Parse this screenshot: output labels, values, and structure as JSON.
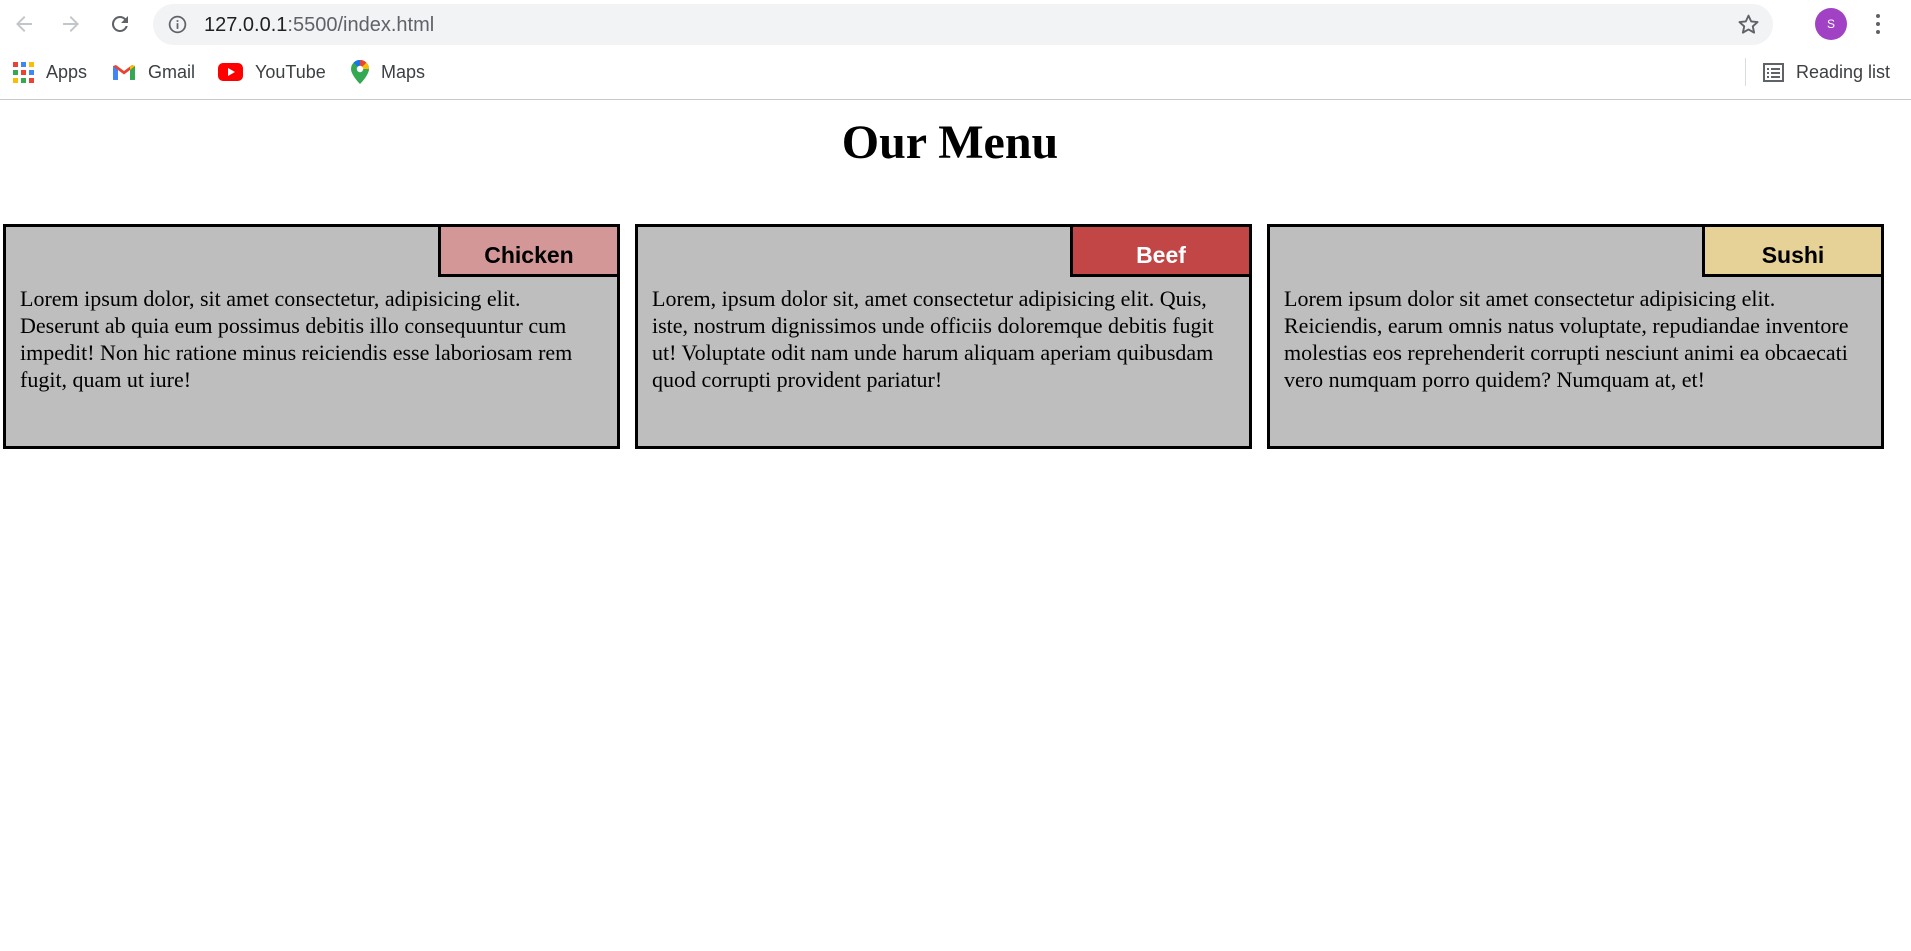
{
  "browser": {
    "url_host": "127.0.0.1",
    "url_path": ":5500/index.html",
    "avatar_letter": "S",
    "bookmarks": [
      {
        "label": "Apps",
        "icon": "apps-grid-icon"
      },
      {
        "label": "Gmail",
        "icon": "gmail-icon"
      },
      {
        "label": "YouTube",
        "icon": "youtube-icon"
      },
      {
        "label": "Maps",
        "icon": "maps-pin-icon"
      }
    ],
    "reading_list_label": "Reading list"
  },
  "page": {
    "title": "Our Menu",
    "cards": [
      {
        "tag": "Chicken",
        "tag_color": "#d49797",
        "tag_text_color": "#000000",
        "text": "Lorem ipsum dolor, sit amet consectetur, adipisicing elit. Deserunt ab quia eum possimus debitis illo consequuntur cum impedit! Non hic ratione minus reiciendis esse laboriosam rem fugit, quam ut iure!"
      },
      {
        "tag": "Beef",
        "tag_color": "#c34646",
        "tag_text_color": "#ffffff",
        "text": "Lorem, ipsum dolor sit, amet consectetur adipisicing elit. Quis, iste, nostrum dignissimos unde officiis doloremque debitis fugit ut! Voluptate odit nam unde harum aliquam aperiam quibusdam quod corrupti provident pariatur!"
      },
      {
        "tag": "Sushi",
        "tag_color": "#e6d197",
        "tag_text_color": "#000000",
        "text": "Lorem ipsum dolor sit amet consectetur adipisicing elit. Reiciendis, earum omnis natus voluptate, repudiandae inventore molestias eos reprehenderit corrupti nesciunt animi ea obcaecati vero numquam porro quidem? Numquam at, et!"
      }
    ]
  }
}
